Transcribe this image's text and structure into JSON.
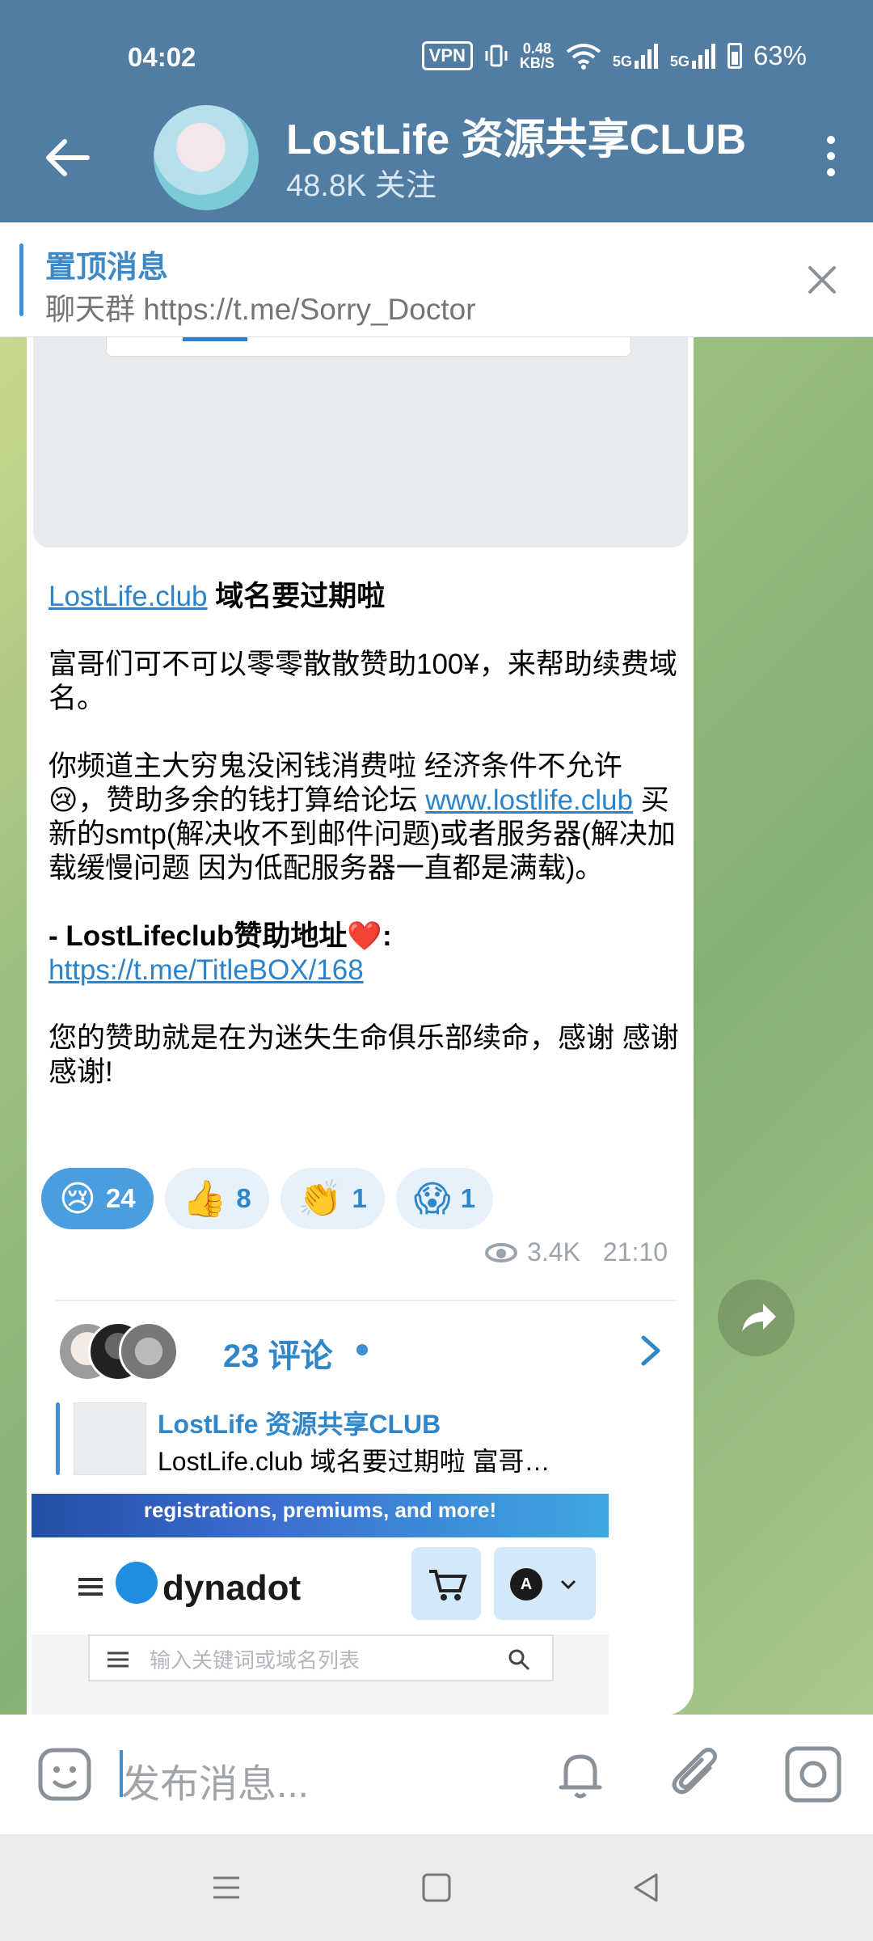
{
  "status": {
    "time": "04:02",
    "vpn": "VPN",
    "speed_top": "0.48",
    "speed_bottom": "KB/S",
    "net1": "5G",
    "net2": "5G",
    "battery": "63%"
  },
  "header": {
    "title": "LostLife 资源共享CLUB",
    "subtitle": "48.8K 关注"
  },
  "pinned": {
    "title": "置顶消息",
    "text": "聊天群 https://t.me/Sorry_Doctor"
  },
  "message": {
    "heading_link": "LostLife.club",
    "heading_text": " 域名要过期啦",
    "para1": "富哥们可不可以零零散散赞助100¥，来帮助续费域名。",
    "para2_a": "你频道主大穷鬼没闲钱消费啦 经济条件不允许😢，赞助多余的钱打算给论坛 ",
    "para2_link": "www.lostlife.club",
    "para2_b": " 买新的smtp(解决收不到邮件问题)或者服务器(解决加载缓慢问题 因为低配服务器一直都是满载)。",
    "sponsor_label": "- LostLifeclub赞助地址❤️:",
    "sponsor_link": "https://t.me/TitleBOX/168",
    "para4": "您的赞助就是在为迷失生命俱乐部续命，感谢 感谢 感谢!",
    "reactions": [
      {
        "emoji": "😢",
        "count": "24"
      },
      {
        "emoji": "👍",
        "count": "8"
      },
      {
        "emoji": "👏",
        "count": "1"
      },
      {
        "emoji": "😱",
        "count": "1"
      }
    ],
    "views": "3.4K",
    "time": "21:10",
    "comments": "23 评论"
  },
  "reply": {
    "title": "LostLife 资源共享CLUB",
    "snippet": "LostLife.club 域名要过期啦  富哥…",
    "banner": "registrations, premiums, and more!",
    "site_name": "dynadot",
    "account_letter": "A",
    "search_placeholder": "输入关键词或域名列表"
  },
  "input": {
    "placeholder": "发布消息..."
  },
  "colors": {
    "header": "#527da3",
    "accent": "#2f86c9",
    "active_reaction": "#4a9ede"
  }
}
